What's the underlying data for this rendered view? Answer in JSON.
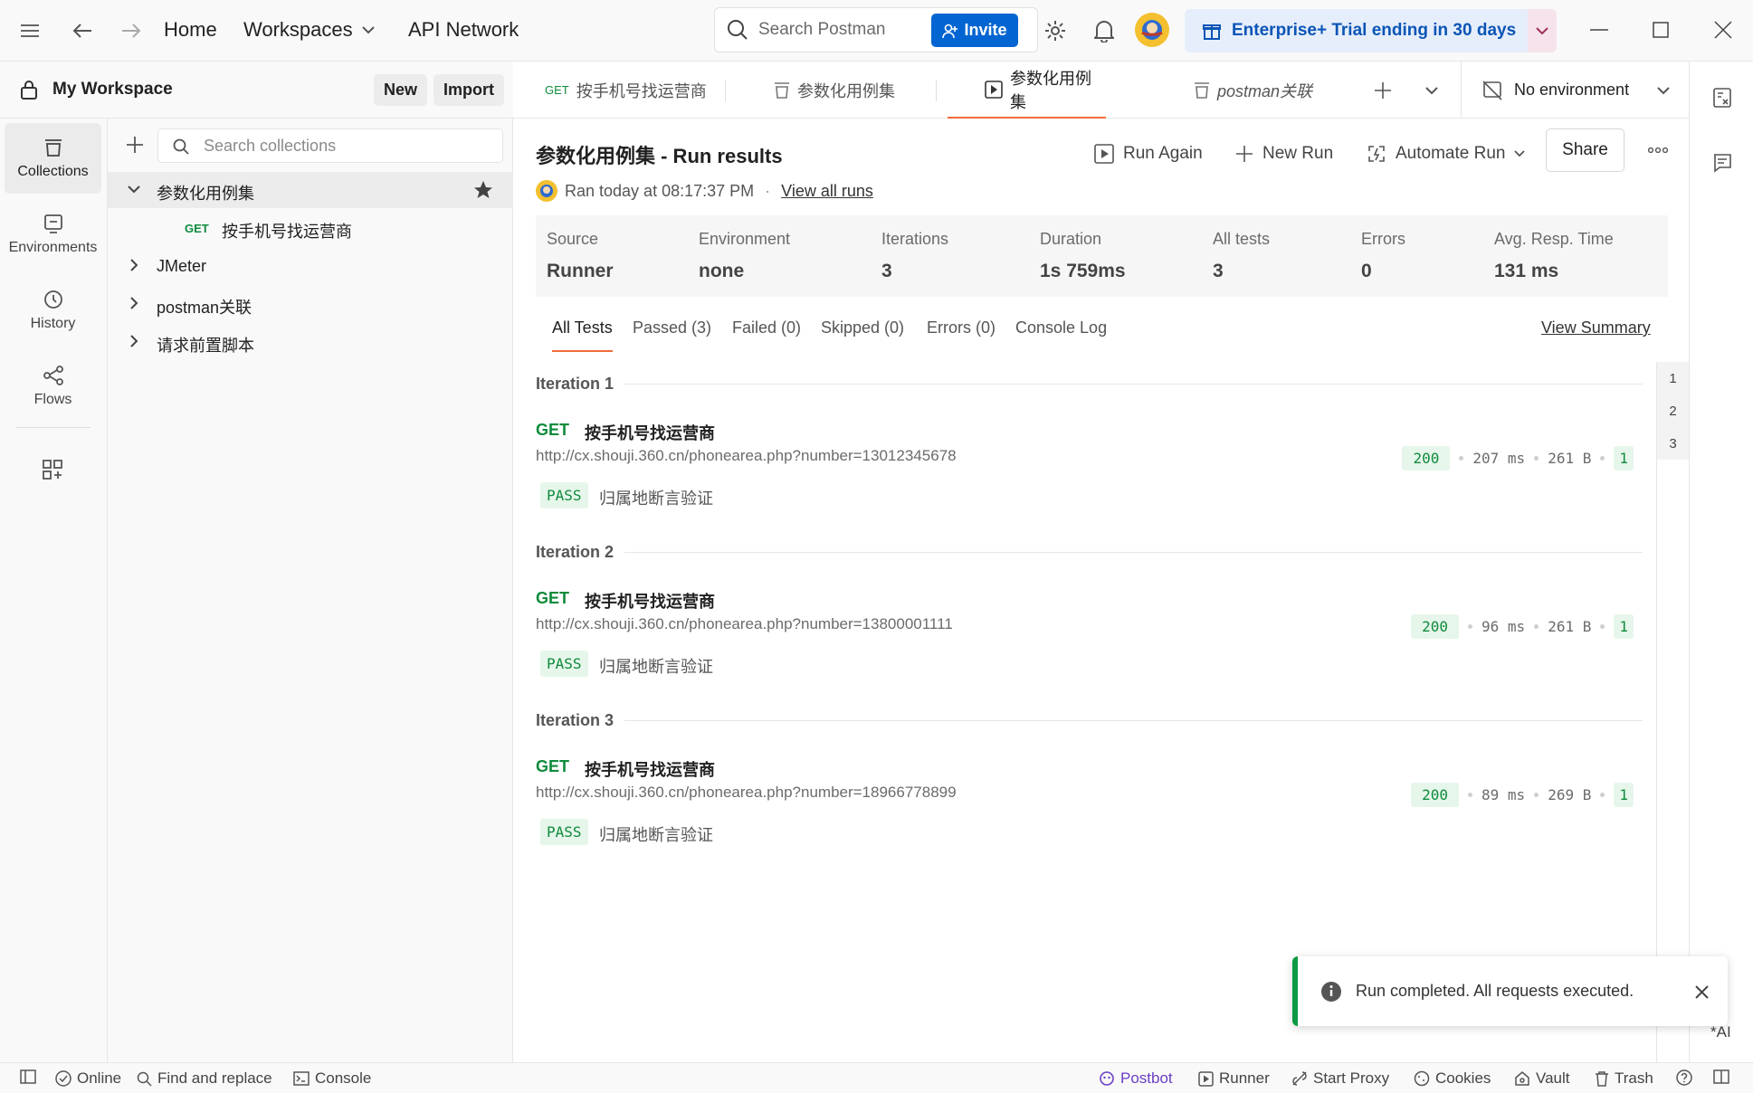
{
  "topbar": {
    "home": "Home",
    "workspaces": "Workspaces",
    "api_network": "API Network",
    "search_placeholder": "Search Postman",
    "invite": "Invite",
    "trial": "Enterprise+ Trial ending in 30 days"
  },
  "workspace": {
    "name": "My Workspace",
    "new_label": "New",
    "import_label": "Import"
  },
  "rail": [
    {
      "label": "Collections",
      "icon": "collections-icon"
    },
    {
      "label": "Environments",
      "icon": "environments-icon"
    },
    {
      "label": "History",
      "icon": "history-icon"
    },
    {
      "label": "Flows",
      "icon": "flows-icon"
    }
  ],
  "sidebar": {
    "search_placeholder": "Search collections",
    "tree": [
      {
        "label": "参数化用例集",
        "expanded": true
      },
      {
        "method": "GET",
        "label": "按手机号找运营商"
      },
      {
        "label": "JMeter"
      },
      {
        "label": "postman关联"
      },
      {
        "label": "请求前置脚本"
      }
    ]
  },
  "tabs": [
    {
      "method": "GET",
      "label": "按手机号找运营商"
    },
    {
      "label": "参数化用例集"
    },
    {
      "label": "参数化用例集",
      "active": true
    },
    {
      "label": "postman关联"
    }
  ],
  "environment": "No environment",
  "run": {
    "title": "参数化用例集 - Run results",
    "ran": "Ran today at 08:17:37 PM",
    "view_all_runs": "View all runs",
    "actions": {
      "run_again": "Run Again",
      "new_run": "New Run",
      "automate_run": "Automate Run",
      "share": "Share"
    },
    "stats": [
      {
        "label": "Source",
        "value": "Runner"
      },
      {
        "label": "Environment",
        "value": "none"
      },
      {
        "label": "Iterations",
        "value": "3"
      },
      {
        "label": "Duration",
        "value": "1s 759ms"
      },
      {
        "label": "All tests",
        "value": "3"
      },
      {
        "label": "Errors",
        "value": "0"
      },
      {
        "label": "Avg. Resp. Time",
        "value": "131 ms"
      }
    ],
    "result_tabs": [
      "All Tests",
      "Passed (3)",
      "Failed (0)",
      "Skipped (0)",
      "Errors (0)",
      "Console Log"
    ],
    "view_summary": "View Summary",
    "iterations": [
      {
        "label": "Iteration 1",
        "method": "GET",
        "name": "按手机号找运营商",
        "url": "http://cx.shouji.360.cn/phonearea.php?number=13012345678",
        "status": "200",
        "time": "207 ms",
        "size": "261 B",
        "tests": "1",
        "result": "PASS",
        "test_name": "归属地断言验证"
      },
      {
        "label": "Iteration 2",
        "method": "GET",
        "name": "按手机号找运营商",
        "url": "http://cx.shouji.360.cn/phonearea.php?number=13800001111",
        "status": "200",
        "time": "96 ms",
        "size": "261 B",
        "tests": "1",
        "result": "PASS",
        "test_name": "归属地断言验证"
      },
      {
        "label": "Iteration 3",
        "method": "GET",
        "name": "按手机号找运营商",
        "url": "http://cx.shouji.360.cn/phonearea.php?number=18966778899",
        "status": "200",
        "time": "89 ms",
        "size": "269 B",
        "tests": "1",
        "result": "PASS",
        "test_name": "归属地断言验证"
      }
    ],
    "iteration_index": [
      "1",
      "2",
      "3"
    ]
  },
  "toast": "Run completed. All requests executed.",
  "ai_label": "*AI",
  "statusbar": {
    "online": "Online",
    "find_replace": "Find and replace",
    "console": "Console",
    "postbot": "Postbot",
    "runner": "Runner",
    "start_proxy": "Start Proxy",
    "cookies": "Cookies",
    "vault": "Vault",
    "trash": "Trash"
  },
  "colors": {
    "accent": "#f26b3a",
    "primary": "#0265d2",
    "success": "#0f8b3c"
  }
}
